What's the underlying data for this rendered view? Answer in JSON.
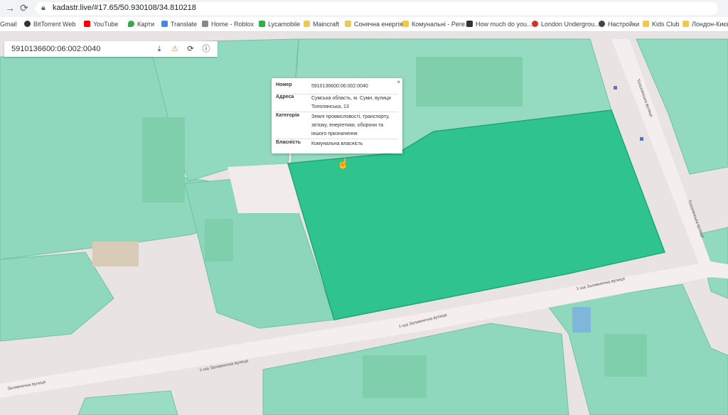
{
  "browser": {
    "url": "kadastr.live/#17.65/50.930108/34.810218",
    "bookmarks": [
      {
        "label": "Gmail",
        "icon": "gmail-icon",
        "color": "#ea4335"
      },
      {
        "label": "BitTorrent Web",
        "icon": "bittorrent-icon",
        "color": "#333333"
      },
      {
        "label": "YouTube",
        "icon": "youtube-icon",
        "color": "#ff0000"
      },
      {
        "label": "Карти",
        "icon": "maps-icon",
        "color": "#34a853"
      },
      {
        "label": "Translate",
        "icon": "translate-icon",
        "color": "#4285f4"
      },
      {
        "label": "Home - Roblox",
        "icon": "roblox-icon",
        "color": "#777777"
      },
      {
        "label": "Lycamobile",
        "icon": "lycamobile-icon",
        "color": "#2db24a"
      },
      {
        "label": "Maincraft",
        "icon": "folder-icon",
        "color": "#f2c94c"
      },
      {
        "label": "Сонячна енергія",
        "icon": "folder-icon",
        "color": "#f2c94c"
      },
      {
        "label": "Комунальні - Pere...",
        "icon": "folder-icon",
        "color": "#f2c94c"
      },
      {
        "label": "How much do you...",
        "icon": "page-icon",
        "color": "#333333"
      },
      {
        "label": "London Undergrou...",
        "icon": "pin-icon",
        "color": "#d93025"
      },
      {
        "label": "Настройки",
        "icon": "gear-icon",
        "color": "#444444"
      },
      {
        "label": "Kids Club",
        "icon": "folder-icon",
        "color": "#f2c94c"
      },
      {
        "label": "Лондон-Києв",
        "icon": "folder-icon",
        "color": "#f2c94c"
      }
    ]
  },
  "search": {
    "value": "5910136600:06:002:0040"
  },
  "popup": {
    "rows": [
      {
        "label": "Номер",
        "value": "5910136600:06:002:0040"
      },
      {
        "label": "Адреса",
        "value": "Сумська область, м. Суми, вулиця Тополянська, 13"
      },
      {
        "label": "Категорія",
        "value": "Землі промисловості, транспорту, зв'язку, енергетики, оборони та іншого призначення"
      },
      {
        "label": "Власність",
        "value": "Комунальна власність"
      }
    ],
    "close": "×"
  },
  "streets": {
    "zalyvna_1": "1-ша Заливнична вулиця",
    "zalyvna_2": "1-ша Заливнична вулиця",
    "zalyvna_3": "1-ша Заливнична вулиця",
    "zalyvna_4": "Заливнична вулиця",
    "topolyanska_1": "Тополянська вулиця",
    "topolyanska_2": "Тополянська вулиця"
  },
  "colors": {
    "parcel": "#8fd8be",
    "selected_parcel": "#2fc38e",
    "road": "#f4eeee",
    "building": "#79caa6"
  }
}
